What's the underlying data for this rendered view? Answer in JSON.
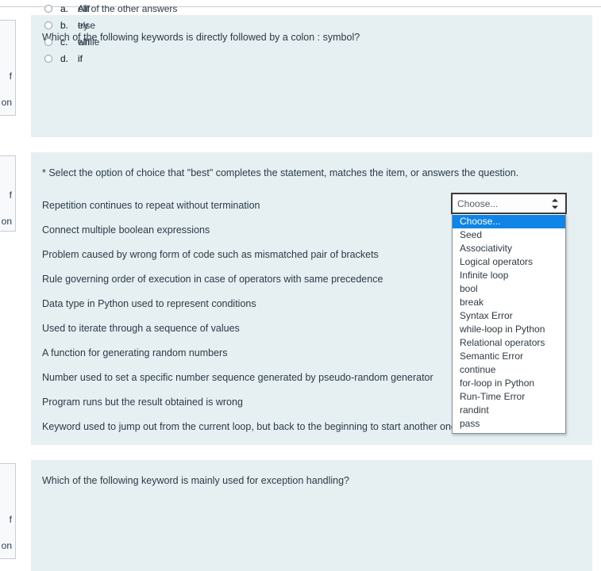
{
  "nav_stubs": [
    {
      "line1": "f",
      "line2": "on"
    },
    {
      "line1": "f",
      "line2": "on"
    },
    {
      "line1": "f",
      "line2": "on"
    }
  ],
  "question_1": {
    "text": "Which of the following keywords is directly followed by a colon : symbol?",
    "options": [
      {
        "letter": "a.",
        "label": "All of the other answers"
      },
      {
        "letter": "b.",
        "label": "else"
      },
      {
        "letter": "c.",
        "label": "elif"
      },
      {
        "letter": "d.",
        "label": "if"
      }
    ]
  },
  "question_2": {
    "instruction": "* Select the option of choice that \"best\" completes the statement, matches the item, or answers the question.",
    "statements": [
      "Repetition continues to repeat without termination",
      "Connect multiple boolean expressions",
      "Problem caused by wrong form of code such as mismatched pair of brackets",
      "Rule governing order of execution in case of operators with same precedence",
      "Data type in Python used to represent conditions",
      "Used to iterate through a sequence of values",
      "A function for generating random numbers",
      "Number used to set a specific number sequence generated by pseudo-random generator",
      "Program runs but the result obtained is wrong",
      "Keyword used to jump out from the current loop, but back to the beginning to start another one"
    ],
    "select": {
      "value": "Choose...",
      "icon": "spinner-arrows-icon",
      "options": [
        "Choose...",
        "Seed",
        "Associativity",
        "Logical operators",
        "Infinite loop",
        "bool",
        "break",
        "Syntax Error",
        "while-loop in Python",
        "Relational operators",
        "Semantic Error",
        "continue",
        "for-loop in Python",
        "Run-Time Error",
        "randint",
        "pass"
      ],
      "selected_index": 0,
      "highlight_color": "#1184e8"
    }
  },
  "question_3": {
    "text": "Which of the following keyword is mainly used for exception handling?",
    "options": [
      {
        "letter": "a.",
        "label": "elif"
      },
      {
        "letter": "b.",
        "label": "try"
      },
      {
        "letter": "c.",
        "label": "while"
      },
      {
        "letter": "d.",
        "label": "if"
      }
    ]
  },
  "colors": {
    "card_background": "#e6f0f2",
    "page_background": "#ffffff",
    "text": "#2b3a47",
    "rule": "#c9cdd2"
  }
}
